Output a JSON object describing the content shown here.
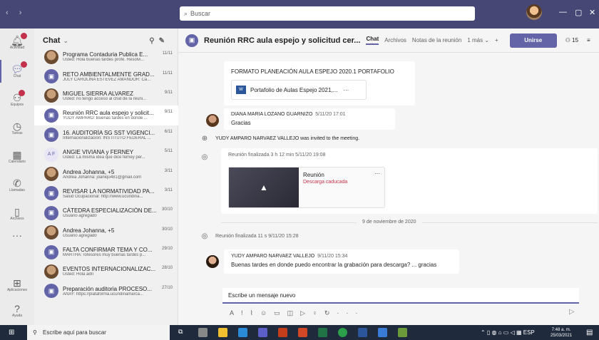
{
  "titlebar": {
    "search_placeholder": "Buscar"
  },
  "rail": [
    {
      "label": "Actividad",
      "icon": "bell-icon",
      "badge": ""
    },
    {
      "label": "Chat",
      "icon": "chat-icon",
      "badge": "",
      "active": true
    },
    {
      "label": "Equipos",
      "icon": "teams-icon",
      "badge": ""
    },
    {
      "label": "Tareas",
      "icon": "tasks-icon",
      "badge": ""
    },
    {
      "label": "Calendario",
      "icon": "calendar-icon",
      "badge": ""
    },
    {
      "label": "Llamadas",
      "icon": "phone-icon",
      "badge": ""
    },
    {
      "label": "Archivos",
      "icon": "files-icon",
      "badge": ""
    },
    {
      "label": "Aplicaciones",
      "icon": "apps-icon",
      "badge": ""
    },
    {
      "label": "Ayuda",
      "icon": "help-icon",
      "badge": ""
    }
  ],
  "chatlist": {
    "title": "Chat",
    "items": [
      {
        "name": "Programa Contaduria Publica E...",
        "date": "11/11",
        "preview": "Usted: Hola buenas tardes profe. Resolvi...",
        "avatar": "photo"
      },
      {
        "name": "RETO AMBIENTALMENTE GRAD...",
        "date": "11/11",
        "preview": "JULY CAROLINA ESTEVEZ AMANDOR: Ca...",
        "avatar": "meet"
      },
      {
        "name": "MIGUEL SIERRA ALVAREZ",
        "date": "9/11",
        "preview": "Usted: no tengo acceso al chat de la reuni...",
        "avatar": "photo"
      },
      {
        "name": "Reunión RRC aula espejo y solicit...",
        "date": "9/11",
        "preview": "YUDY AMPARO: Buenas tardes en donde ...",
        "avatar": "meet",
        "selected": true
      },
      {
        "name": "16. AUDITORÍA SG SST VIGENCI...",
        "date": "6/11",
        "preview": "Internacionalización: INSTITUTO FEDERAL ...",
        "avatar": "meet"
      },
      {
        "name": "ANGIE VIVIANA y FERNEY",
        "date": "5/11",
        "preview": "Usted: La misma idea que dice ferney per...",
        "avatar": "ini",
        "initials": "A F"
      },
      {
        "name": "Andrea Johanna, +5",
        "date": "3/11",
        "preview": "Andrea Johanna: joaniqu481@gmail.com",
        "avatar": "photo"
      },
      {
        "name": "REVISAR LA NORMATIVIDAD PA...",
        "date": "3/11",
        "preview": "Salud Ocupacional: http://www.ucundina...",
        "avatar": "meet"
      },
      {
        "name": "CÁTEDRA ESPECIALIZACIÓN DE...",
        "date": "30/10",
        "preview": "Usuario agregado",
        "avatar": "meet",
        "italic": true
      },
      {
        "name": "Andrea Johanna, +5",
        "date": "30/10",
        "preview": "Usuario agregado",
        "avatar": "photo",
        "italic": true
      },
      {
        "name": "FALTA CONFIRMAR TEMA Y CO...",
        "date": "29/10",
        "preview": "MARTHA: rofesores muy buenas tardes p...",
        "avatar": "meet"
      },
      {
        "name": "EVENTOS INTERNACIONALIZAC...",
        "date": "28/10",
        "preview": "Usted: Hola adri",
        "avatar": "photo"
      },
      {
        "name": "Preparación auditoria PROCESO...",
        "date": "27/10",
        "preview": "ANAY: https://plataforma.ucundinamarca...",
        "avatar": "meet"
      }
    ]
  },
  "meeting": {
    "title": "Reunión RRC aula espejo y solicitud cer...",
    "tabs": [
      "Chat",
      "Archivos",
      "Notas de la reunión",
      "1 más"
    ],
    "join_label": "Unirse",
    "participants": "15"
  },
  "messages": {
    "file_msg_text": "FORMATO PLANEACIÓN AULA ESPEJO 2020.1 PORTAFOLIO",
    "file_name": "Portafolio de Aulas Espejo 2021,...",
    "diana_author": "DIANA MARIA LOZANO GUARNIZO",
    "diana_time": "5/11/20 17:01",
    "diana_text": "Gracias",
    "invited_text": "YUDY AMPARO NARVAEZ VALLEJO was invited to the meeting.",
    "meeting_ended_1": "Reunión finalizada  3 h 12 min   5/11/20 19:08",
    "recording_title": "Reunión",
    "recording_status": "Descarga caducada",
    "date_divider": "9 de noviembre de 2020",
    "meeting_ended_2": "Reunión finalizada  11 s   9/11/20 15:28",
    "yudy_author": "YUDY AMPARO NARVAEZ VALLEJO",
    "yudy_time": "9/11/20 15:34",
    "yudy_text": "Buenas tardes en donde puedo encontrar la grabación para descarga? ... gracias",
    "compose_placeholder": "Escribe un mensaje nuevo"
  },
  "taskbar": {
    "search_placeholder": "Escribe aquí para buscar",
    "lang": "ESP",
    "time": "7:48 a. m.",
    "date": "25/03/2021"
  },
  "colors": {
    "accent": "#6264a7",
    "titlebar": "#464775",
    "error": "#c4314b"
  }
}
